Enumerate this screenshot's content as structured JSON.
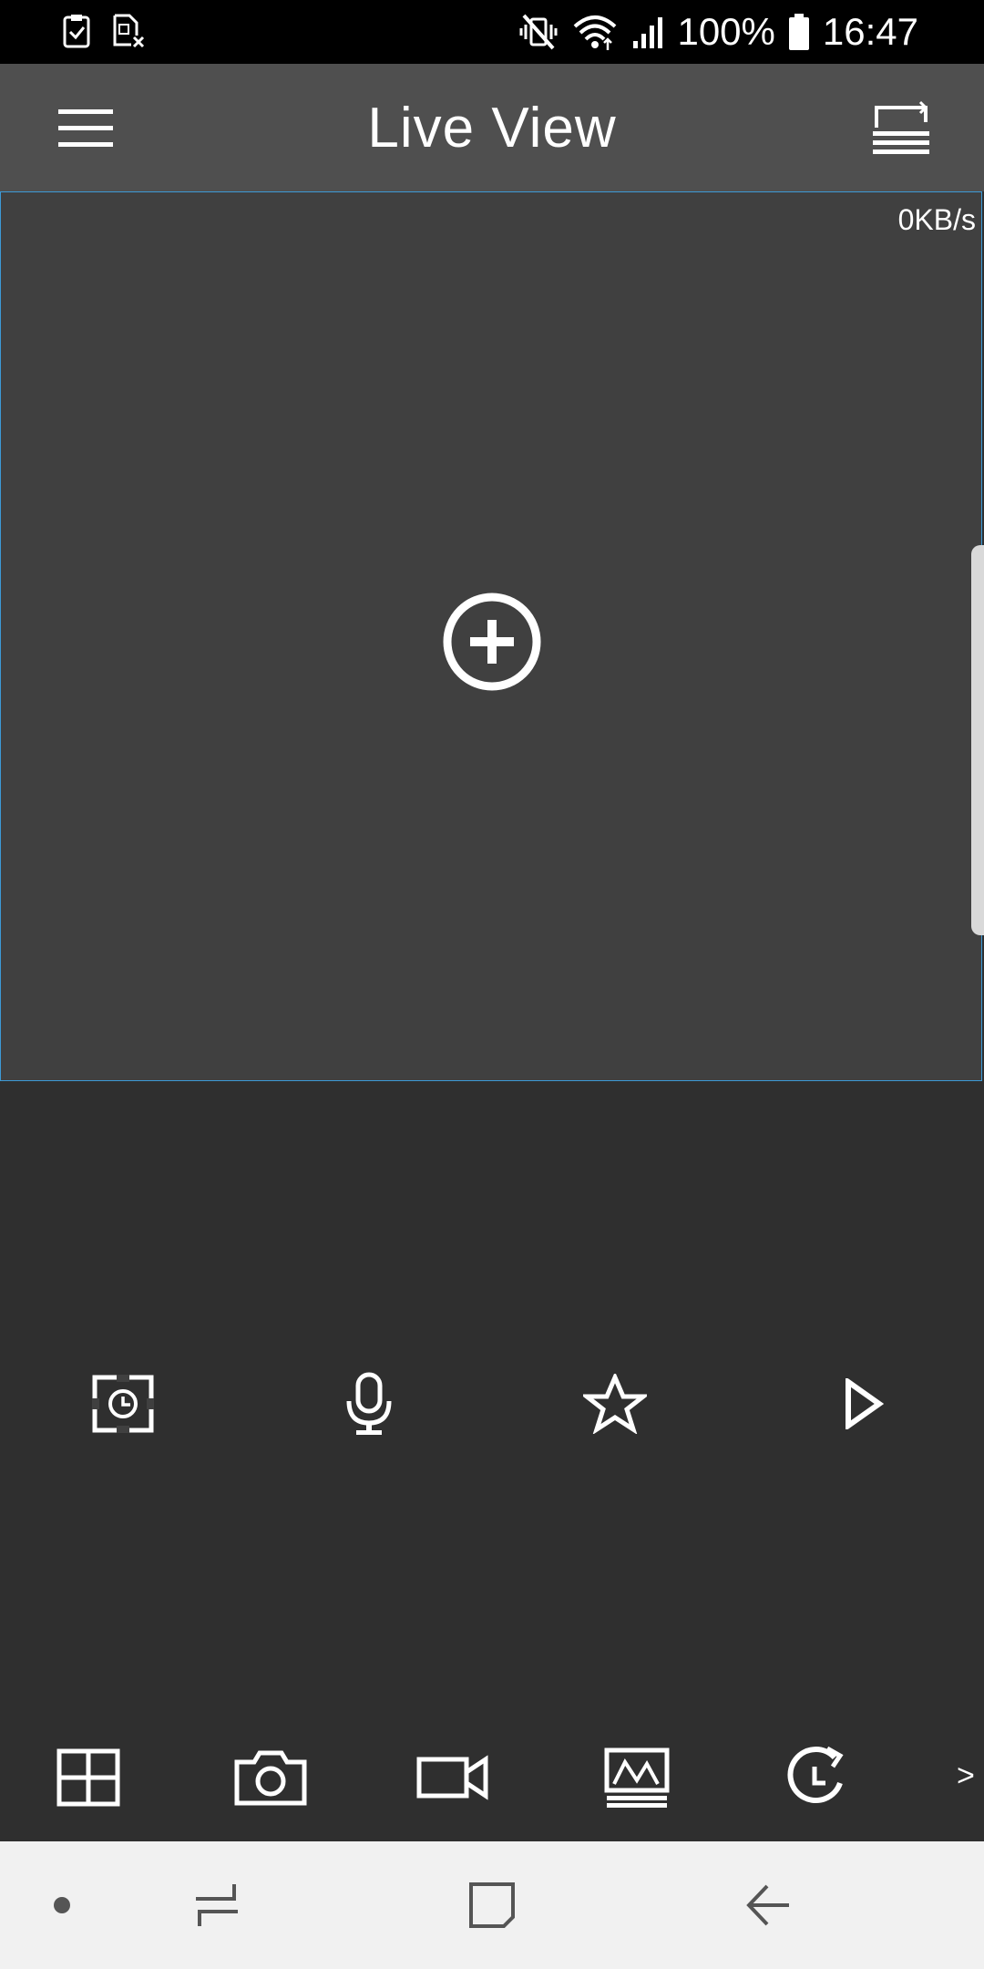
{
  "status_bar": {
    "battery": "100%",
    "time": "16:47",
    "left_icons": [
      "clipboard-check-icon",
      "sim-card-off-icon"
    ],
    "right_icons": [
      "vibrate-mute-icon",
      "wifi-icon",
      "signal-icon",
      "battery-icon"
    ]
  },
  "header": {
    "title": "Live View",
    "left_icon": "hamburger-menu-icon",
    "right_icon": "window-layout-icon"
  },
  "live_view": {
    "bitrate": "0KB/s",
    "add_icon": "add-circle-icon",
    "border_color": "#3d9ad6"
  },
  "controls": [
    {
      "icon": "record-schedule-icon"
    },
    {
      "icon": "microphone-icon"
    },
    {
      "icon": "star-icon"
    },
    {
      "icon": "play-icon"
    }
  ],
  "toolbar": {
    "items": [
      {
        "icon": "grid-layout-icon"
      },
      {
        "icon": "camera-icon"
      },
      {
        "icon": "video-camera-icon"
      },
      {
        "icon": "image-quality-icon"
      },
      {
        "icon": "playback-icon"
      }
    ],
    "more": ">"
  },
  "nav_bar": {
    "items": [
      "dot-icon",
      "recent-apps-icon",
      "home-icon",
      "back-icon"
    ]
  },
  "colors": {
    "status_bar": "#000000",
    "app_bar": "#4f4f4f",
    "live_pane": "#404040",
    "background": "#2f2f2f",
    "nav_bar": "#f1f1f1",
    "icon": "#ffffff"
  }
}
